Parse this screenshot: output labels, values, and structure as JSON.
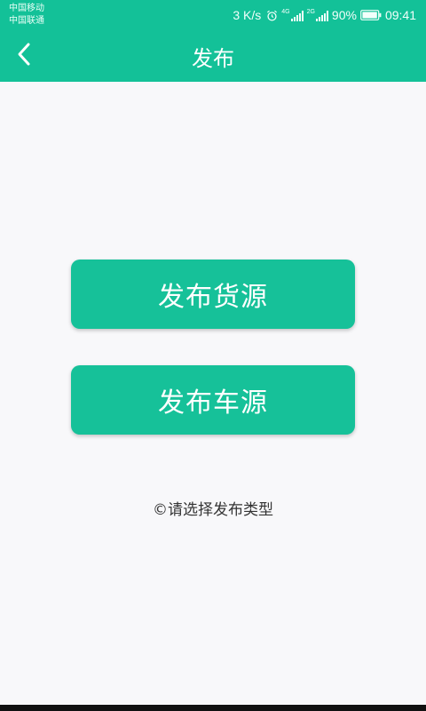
{
  "status_bar": {
    "carrier_1": "中国移动",
    "carrier_2": "中国联通",
    "net_speed": "3 K/s",
    "signal_1_tag": "4G",
    "signal_2_tag": "2G",
    "battery": "90%",
    "time": "09:41",
    "icons": [
      "alarm-icon",
      "signal-icon",
      "signal-icon",
      "battery-icon"
    ]
  },
  "header": {
    "title": "发布",
    "back_icon": "chevron-left-icon"
  },
  "main": {
    "publish_cargo_label": "发布货源",
    "publish_vehicle_label": "发布车源",
    "hint": "©请选择发布类型"
  },
  "colors": {
    "primary": "#13c198",
    "background": "#f8f8fa",
    "button_text": "#ffffff",
    "hint_text": "#333333"
  }
}
